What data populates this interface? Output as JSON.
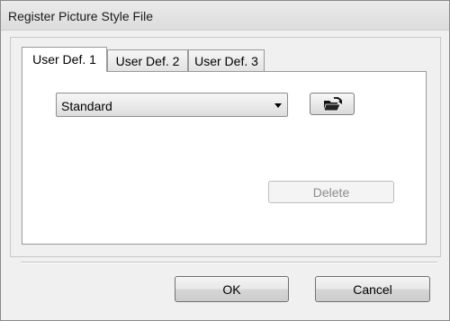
{
  "window": {
    "title": "Register Picture Style File"
  },
  "tabs": [
    {
      "label": "User Def. 1",
      "active": true
    },
    {
      "label": "User Def. 2",
      "active": false
    },
    {
      "label": "User Def. 3",
      "active": false
    }
  ],
  "panel": {
    "style_select": {
      "value": "Standard"
    },
    "open_button_icon": "open-folder-icon",
    "delete_label": "Delete",
    "delete_enabled": false
  },
  "footer": {
    "ok_label": "OK",
    "cancel_label": "Cancel"
  }
}
